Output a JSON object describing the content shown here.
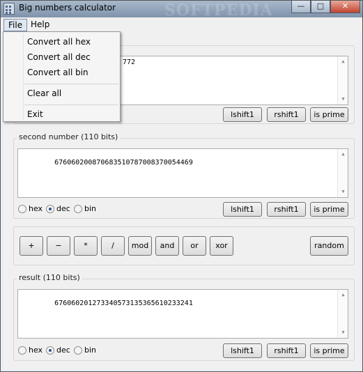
{
  "window": {
    "title": "Big numbers calculator"
  },
  "menu": {
    "file": "File",
    "help": "Help",
    "file_items": [
      "Convert all hex",
      "Convert all dec",
      "Convert all bin",
      "Clear all",
      "Exit"
    ]
  },
  "first_number": {
    "visible_value": "772",
    "buttons": [
      "lshift1",
      "rshift1",
      "is prime"
    ]
  },
  "second_number": {
    "label": "second number (110 bits)",
    "value": "676060200870683510787008370054469",
    "radios": [
      "hex",
      "dec",
      "bin"
    ],
    "selected_radio": "dec",
    "buttons": [
      "lshift1",
      "rshift1",
      "is prime"
    ]
  },
  "operations": {
    "buttons": [
      "+",
      "−",
      "*",
      "/",
      "mod",
      "and",
      "or",
      "xor"
    ],
    "random": "random"
  },
  "result": {
    "label": "result (110 bits)",
    "value": "676060201273340573135365610233241",
    "radios": [
      "hex",
      "dec",
      "bin"
    ],
    "selected_radio": "dec",
    "buttons": [
      "lshift1",
      "rshift1",
      "is prime"
    ]
  },
  "watermark": "SOFTPEDIA"
}
